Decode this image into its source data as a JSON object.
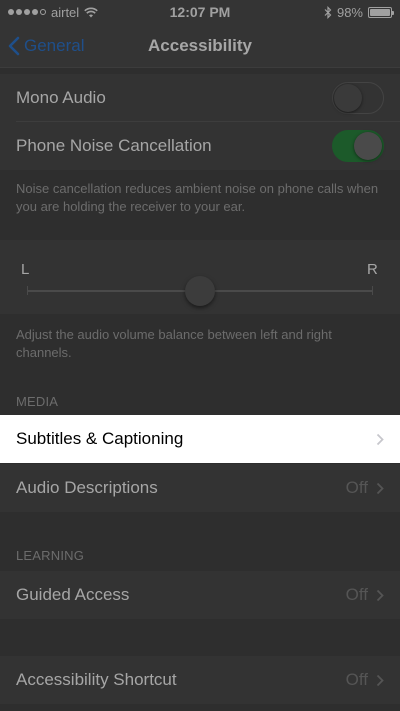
{
  "status_bar": {
    "carrier": "airtel",
    "time": "12:07 PM",
    "battery": "98%",
    "battery_fraction": 0.98
  },
  "nav": {
    "back_label": "General",
    "title": "Accessibility"
  },
  "rows": {
    "mono_audio": {
      "label": "Mono Audio",
      "on": false
    },
    "noise_cancellation": {
      "label": "Phone Noise Cancellation",
      "on": true
    }
  },
  "noise_footer": "Noise cancellation reduces ambient noise on phone calls when you are holding the receiver to your ear.",
  "balance": {
    "left_label": "L",
    "right_label": "R",
    "value": 0.5
  },
  "balance_footer": "Adjust the audio volume balance between left and right channels.",
  "sections": {
    "media": "MEDIA",
    "learning": "LEARNING"
  },
  "media_rows": {
    "subtitles": {
      "label": "Subtitles & Captioning"
    },
    "audio_descriptions": {
      "label": "Audio Descriptions",
      "value": "Off"
    }
  },
  "learning_rows": {
    "guided_access": {
      "label": "Guided Access",
      "value": "Off"
    }
  },
  "shortcut_row": {
    "label": "Accessibility Shortcut",
    "value": "Off"
  },
  "colors": {
    "accent": "#1f4f8a",
    "toggle_on": "#1c5a2a",
    "highlight": "#ffffff"
  }
}
